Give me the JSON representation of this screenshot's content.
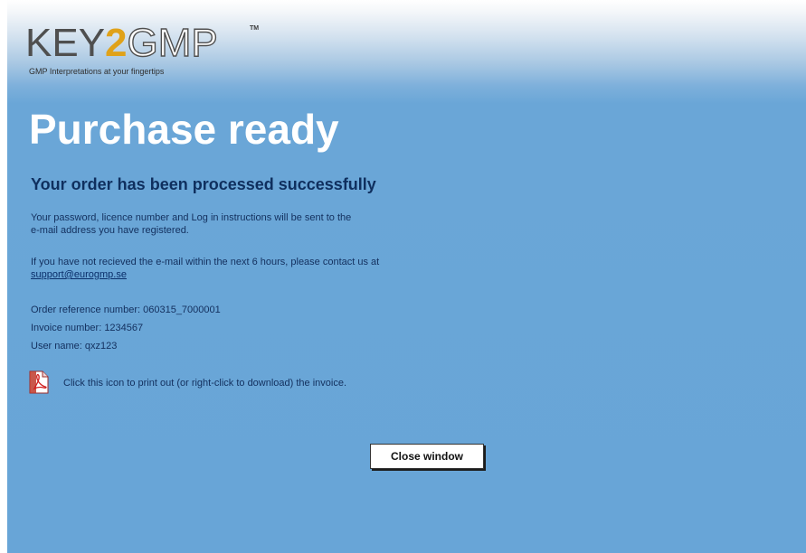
{
  "logo": {
    "key": "KEY",
    "two": "2",
    "gmp": "GMP",
    "tm": "TM",
    "tagline": "GMP Interpretations at your fingertips"
  },
  "page": {
    "title": "Purchase ready",
    "subtitle": "Your order has been processed successfully",
    "info_line1": "Your password, licence number and Log in instructions will be sent to the",
    "info_line2": "e-mail address you have registered.",
    "contact_line": "If you have not recieved the e-mail within the next 6 hours, please contact us at",
    "support_email": "support@eurogmp.se",
    "order_ref": "Order reference number:   060315_7000001",
    "invoice_number": "Invoice number: 1234567",
    "user_name": "User name: qxz123",
    "pdf_instruction": "Click this icon to print out (or right-click to download) the invoice.",
    "close_button": "Close window"
  },
  "icons": {
    "pdf": "pdf-document-icon"
  },
  "colors": {
    "background_blue": "#68a5d7",
    "heading_dark_blue": "#0f2f5e",
    "title_white": "#ffffff",
    "logo_gold": "#e0a21a",
    "logo_gray": "#4f4f4f"
  }
}
